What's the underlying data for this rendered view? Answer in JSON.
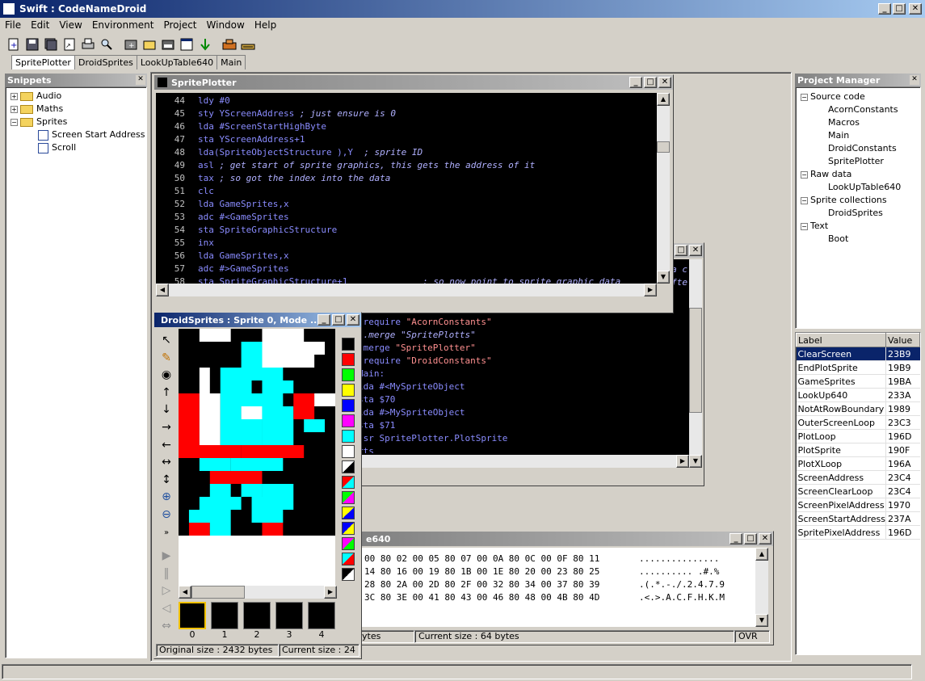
{
  "app": {
    "title": "Swift : CodeNameDroid"
  },
  "menu": [
    "File",
    "Edit",
    "View",
    "Environment",
    "Project",
    "Window",
    "Help"
  ],
  "tabs": [
    "SpritePlotter",
    "DroidSprites",
    "LookUpTable640",
    "Main"
  ],
  "snippets": {
    "title": "Snippets",
    "tree": [
      {
        "label": "Audio",
        "type": "folder",
        "expander": "+"
      },
      {
        "label": "Maths",
        "type": "folder",
        "expander": "+"
      },
      {
        "label": "Sprites",
        "type": "folder",
        "expander": "-"
      },
      {
        "label": "Screen Start Address",
        "type": "file"
      },
      {
        "label": "Scroll",
        "type": "file"
      }
    ]
  },
  "sprite_plotter": {
    "title": "SpritePlotter",
    "lines": [
      {
        "n": "44",
        "code": "ldy #0",
        "comment": ""
      },
      {
        "n": "45",
        "code": "sty YScreenAddress ",
        "comment": "; just ensure is 0"
      },
      {
        "n": "46",
        "code": "lda #ScreenStartHighByte",
        "comment": ""
      },
      {
        "n": "47",
        "code": "sta YScreenAddress+1",
        "comment": ""
      },
      {
        "n": "48",
        "code": "lda(SpriteObjectStructure ),Y  ",
        "comment": "; sprite ID"
      },
      {
        "n": "49",
        "code": "asl ",
        "comment": "; get start of sprite graphics, this gets the address of it"
      },
      {
        "n": "50",
        "code": "tax ",
        "comment": "; so got the index into the data"
      },
      {
        "n": "51",
        "code": "clc",
        "comment": ""
      },
      {
        "n": "52",
        "code": "lda GameSprites,x",
        "comment": ""
      },
      {
        "n": "53",
        "code": "adc #<GameSprites",
        "comment": ""
      },
      {
        "n": "54",
        "code": "sta SpriteGraphicStructure",
        "comment": ""
      },
      {
        "n": "55",
        "code": "inx",
        "comment": ""
      },
      {
        "n": "56",
        "code": "lda GameSprites,x",
        "comment": ""
      },
      {
        "n": "57",
        "code": "adc #>GameSprites",
        "comment": ""
      },
      {
        "n": "58",
        "code": "sta SpriteGraphicStructure+1              ",
        "comment": "; so now point to sprite graphic data"
      }
    ]
  },
  "main_window": {
    "lines": [
      {
        "a": ".require ",
        "b": "\"AcornConstants\"",
        "kind": "str"
      },
      {
        "a": ";.merge \"SpritePlotts\"",
        "b": "",
        "kind": "cmt"
      },
      {
        "a": ".merge ",
        "b": "\"SpritePlotter\"",
        "kind": "str"
      },
      {
        "a": ".require ",
        "b": "\"DroidConstants\"",
        "kind": "str"
      },
      {
        "a": "Main:",
        "b": "",
        "kind": ""
      },
      {
        "a": "lda #<MySpriteObject",
        "b": "",
        "kind": ""
      },
      {
        "a": "sta $70",
        "b": "",
        "kind": ""
      },
      {
        "a": "lda #>MySpriteObject",
        "b": "",
        "kind": ""
      },
      {
        "a": "sta $71",
        "b": "",
        "kind": ""
      },
      {
        "a": "jsr SpritePlotter.PlotSprite",
        "b": "",
        "kind": ""
      },
      {
        "a": "rts",
        "b": "",
        "kind": ""
      }
    ],
    "peek": [
      "a c",
      "ofte"
    ]
  },
  "lookup": {
    "title_fragment": "e640",
    "hex": [
      "00 80 02 00 05 80 07 00 0A 80 0C 00 0F 80 11",
      "14 80 16 00 19 80 1B 00 1E 80 20 00 23 80 25",
      "28 80 2A 00 2D 80 2F 00 32 80 34 00 37 80 39",
      "3C 80 3E 00 41 80 43 00 46 80 48 00 4B 80 4D"
    ],
    "ascii": [
      "...............",
      ".......... .#.%",
      ".(.*.-./.2.4.7.9",
      ".<.>.A.C.F.H.K.M"
    ],
    "status_left": "ytes",
    "status_mid": "Current size : 64 bytes",
    "status_right": "OVR"
  },
  "droid": {
    "title": "DroidSprites :  Sprite 0, Mode ...",
    "frames": [
      "0",
      "1",
      "2",
      "3",
      "4"
    ],
    "status_left": "Original size : 2432 bytes",
    "status_right": "Current size : 24",
    "palette_colors": [
      "#000000",
      "#ff0000",
      "#00ff00",
      "#ffff00",
      "#0000ff",
      "#ff00ff",
      "#00ffff",
      "#ffffff"
    ]
  },
  "project": {
    "title": "Project Manager",
    "tree": [
      {
        "label": "Source code",
        "level": 0,
        "exp": "-"
      },
      {
        "label": "AcornConstants",
        "level": 1
      },
      {
        "label": "Macros",
        "level": 1
      },
      {
        "label": "Main",
        "level": 1
      },
      {
        "label": "DroidConstants",
        "level": 1
      },
      {
        "label": "SpritePlotter",
        "level": 1
      },
      {
        "label": "Raw data",
        "level": 0,
        "exp": "-"
      },
      {
        "label": "LookUpTable640",
        "level": 1
      },
      {
        "label": "Sprite collections",
        "level": 0,
        "exp": "-"
      },
      {
        "label": "DroidSprites",
        "level": 1
      },
      {
        "label": "Text",
        "level": 0,
        "exp": "-"
      },
      {
        "label": "Boot",
        "level": 1
      }
    ],
    "label_header": "Label",
    "value_header": "Value",
    "rows": [
      [
        "ClearScreen",
        "23B9"
      ],
      [
        "EndPlotSprite",
        "19B9"
      ],
      [
        "GameSprites",
        "19BA"
      ],
      [
        "LookUp640",
        "233A"
      ],
      [
        "NotAtRowBoundary",
        "1989"
      ],
      [
        "OuterScreenLoop",
        "23C3"
      ],
      [
        "PlotLoop",
        "196D"
      ],
      [
        "PlotSprite",
        "190F"
      ],
      [
        "PlotXLoop",
        "196A"
      ],
      [
        "ScreenAddress",
        "23C4"
      ],
      [
        "ScreenClearLoop",
        "23C4"
      ],
      [
        "ScreenPixelAddress",
        "1970"
      ],
      [
        "ScreenStartAddress",
        "237A"
      ],
      [
        "SpritePixelAddress",
        "196D"
      ]
    ]
  }
}
